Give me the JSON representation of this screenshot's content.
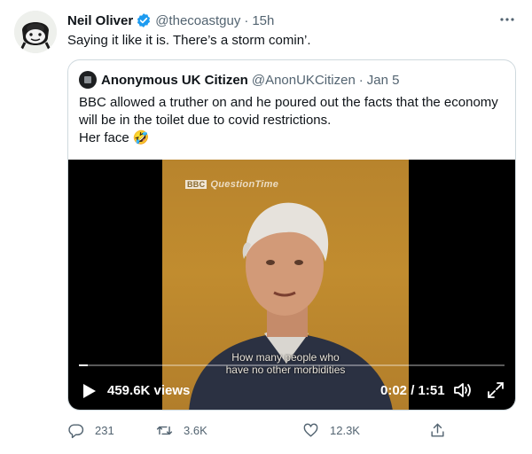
{
  "tweet": {
    "author_name": "Neil Oliver",
    "handle": "@thecoastguy",
    "separator": "·",
    "time": "15h",
    "text": "Saying it like it is. There’s a storm comin’.",
    "verified_color": "#1d9bf0"
  },
  "quoted": {
    "author_name": "Anonymous UK Citizen",
    "handle": "@AnonUKCitizen",
    "separator": "·",
    "date": "Jan 5",
    "text_line1": "BBC allowed a truther on and he poured out the facts that the economy",
    "text_line2": "will be in the toilet due to covid restrictions.",
    "text_line3": "Her face 🤣"
  },
  "video": {
    "logo_bbc": "BBC",
    "logo_title": "QuestionTime",
    "caption_line1": "How many people who",
    "caption_line2": "have no other morbidities",
    "views": "459.6K views",
    "timecode": "0:02 / 1:51",
    "progress": 0.02
  },
  "actions": {
    "replies": "231",
    "retweets": "3.6K",
    "likes": "12.3K"
  },
  "colors": {
    "secondary_text": "#536471",
    "border": "#cfd9de"
  }
}
